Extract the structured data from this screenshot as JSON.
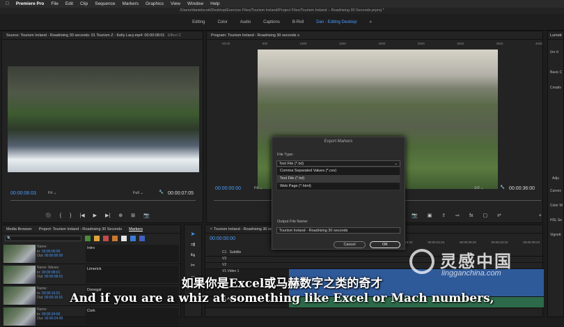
{
  "menubar": {
    "apple": "",
    "app": "Premiere Pro",
    "items": [
      "File",
      "Edit",
      "Clip",
      "Sequence",
      "Markers",
      "Graphics",
      "View",
      "Window",
      "Help"
    ]
  },
  "titlebar": {
    "path": "/Users/danielscott/Desktop/Exercise Files/Tourism Ireland/Project Files/Tourism Ireland – Roadrising 30 Seconds.prproj *"
  },
  "workspaces": [
    "Editing",
    "Color",
    "Audio",
    "Captions",
    "B-Roll",
    "Dan - Editing Desktop"
  ],
  "workspace_active": "Dan - Editing Desktop",
  "source": {
    "tab": "Source: Tourism Ireland - Roadrising 30 seconds: 01 Tourism Z - Kelly Lacy.mp4: 00:00:08:01",
    "tab2": "Effect C",
    "timecode": "00:00:06:03",
    "fit": "Fit",
    "full": "Full",
    "duration": "00:00:07:05"
  },
  "program": {
    "tab": "Program: Tourism Ireland - Roadrising 30 seconds",
    "timecode": "00:00:00:00",
    "fit": "Fit",
    "ratio": "1/2",
    "duration": "00:00:36:00",
    "ruler": [
      "00:00",
      "500",
      "1000",
      "1500",
      "2000",
      "2500",
      "3000",
      "3500",
      "4000"
    ]
  },
  "right_panel": {
    "tab": "Lumetr",
    "items": [
      "(no cl",
      "Basic C",
      "Creativ",
      "Adju",
      "Curves",
      "Color W",
      "HSL Se",
      "Vignett"
    ]
  },
  "dialog": {
    "title": "Export Markers",
    "file_type_label": "File Type:",
    "selected": "Text File (*.txt)",
    "options": [
      "Comma Separated Values (*.csv)",
      "Text File (*.txt)",
      "Web Page (*.html)"
    ],
    "output_label": "Output File Name:",
    "output_value": "Tourism Ireland - Roadrising 30 seconds",
    "cancel": "Cancel",
    "ok": "OK"
  },
  "bottom_left": {
    "tabs": [
      "Media Browser",
      "Project: Tourism Ireland - Roadrising 30 Seconds",
      "Markers"
    ],
    "rows": [
      {
        "name_label": "Name:",
        "in_label": "In:",
        "out_label": "Out:",
        "in": "00:00:00:00",
        "out": "00:00:00:00",
        "marker": "Intro"
      },
      {
        "name_label": "Name:",
        "in_label": "In:",
        "out_label": "Out:",
        "name": "Waves",
        "in": "00:00:08:01",
        "out": "00:00:08:01",
        "marker": "Limerick"
      },
      {
        "name_label": "Name:",
        "in_label": "In:",
        "out_label": "Out:",
        "in": "00:00:16:01",
        "out": "00:00:16:01",
        "marker": "Donegal"
      },
      {
        "name_label": "Name:",
        "in_label": "In:",
        "out_label": "Out:",
        "in": "00:00:24:00",
        "out": "00:00:24:00",
        "marker": "Cork"
      }
    ],
    "colors": [
      "#4c8a3c",
      "#e0a33a",
      "#c34a4a",
      "#c77a2e",
      "#e6e6e6",
      "#3a7bd5",
      "#4060c0"
    ]
  },
  "timeline": {
    "tab": "Tourism Ireland - Roadrising 30 seco",
    "timecode": "00:00:00:00",
    "ruler": [
      "00:19:23",
      "00:00:24:23",
      "00:00:29:23",
      "00:00:34:23",
      "00:00:39:23"
    ],
    "tracks": [
      "C1",
      "V3",
      "V2",
      "V1",
      "A1"
    ],
    "track_labels": {
      "subtitle": "Subtitle",
      "video1": "Video 1",
      "audio1": "Audio 1"
    }
  },
  "subtitles": {
    "cn": "如果你是Excel或马赫数字之类的奇才",
    "en": "And if you are a whiz at something like Excel or Mach numbers,"
  },
  "watermark": {
    "cn": "灵感中国",
    "en": "lingganchina.com"
  }
}
